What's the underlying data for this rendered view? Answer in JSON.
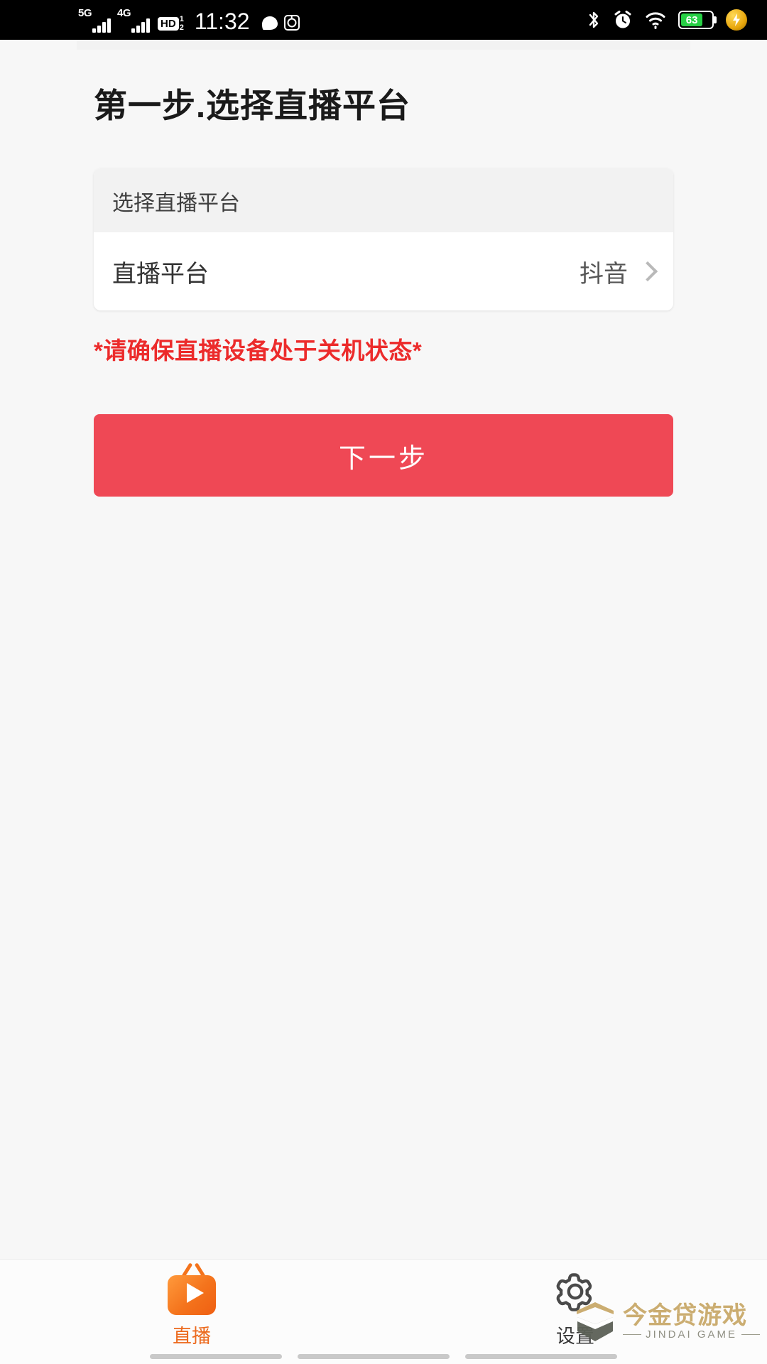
{
  "status_bar": {
    "network_primary": "5G",
    "network_secondary": "4G",
    "hd_label": "HD",
    "hd_sim_top": "1",
    "hd_sim_bottom": "2",
    "time": "11:32",
    "battery_percent": "63",
    "icons": [
      "message-icon",
      "camera-icon",
      "bluetooth-icon",
      "alarm-icon",
      "wifi-icon",
      "battery-icon",
      "fast-charge-icon"
    ],
    "colors": {
      "battery_fill": "#27d045",
      "charge_bolt": "#e8a70d"
    }
  },
  "page": {
    "title": "第一步.选择直播平台"
  },
  "card": {
    "header": "选择直播平台",
    "row_label": "直播平台",
    "row_value": "抖音"
  },
  "warning": {
    "text": "*请确保直播设备处于关机状态*",
    "color": "#ec2b2b"
  },
  "primary_button": {
    "label": "下一步",
    "color": "#ef4855"
  },
  "bottom_nav": {
    "items": [
      {
        "label": "直播",
        "icon": "tv-live-icon",
        "active": true
      },
      {
        "label": "设置",
        "icon": "gear-icon",
        "active": false
      }
    ],
    "active_color": "#ec6a1e"
  },
  "watermark": {
    "main": "今金贷游戏",
    "sub": "JINDAI GAME",
    "color": "#c9a96a"
  }
}
